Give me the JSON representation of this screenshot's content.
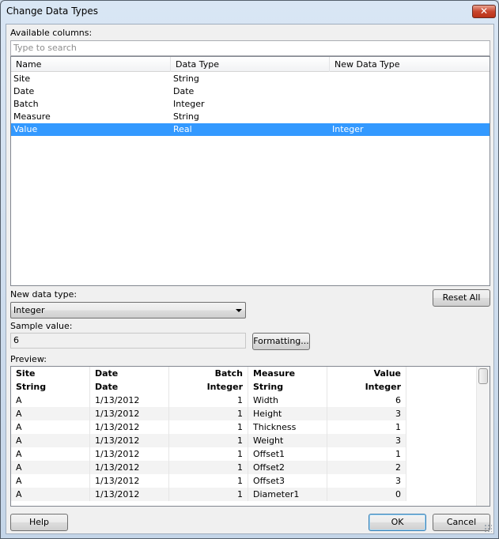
{
  "window": {
    "title": "Change Data Types",
    "close_glyph": "✕"
  },
  "available": {
    "label": "Available columns:",
    "search_placeholder": "Type to search",
    "headers": [
      "Name",
      "Data Type",
      "New Data Type"
    ],
    "rows": [
      {
        "name": "Site",
        "type": "String",
        "new_type": ""
      },
      {
        "name": "Date",
        "type": "Date",
        "new_type": ""
      },
      {
        "name": "Batch",
        "type": "Integer",
        "new_type": ""
      },
      {
        "name": "Measure",
        "type": "String",
        "new_type": ""
      },
      {
        "name": "Value",
        "type": "Real",
        "new_type": "Integer",
        "selected": true
      }
    ]
  },
  "new_type": {
    "label": "New data type:",
    "value": "Integer"
  },
  "reset_all_label": "Reset All",
  "sample": {
    "label": "Sample value:",
    "value": "6"
  },
  "formatting_label": "Formatting...",
  "preview": {
    "label": "Preview:",
    "headers": [
      "Site",
      "Date",
      "Batch",
      "Measure",
      "Value"
    ],
    "types": [
      "String",
      "Date",
      "Integer",
      "String",
      "Integer"
    ],
    "rows": [
      [
        "A",
        "1/13/2012",
        "1",
        "Width",
        "6"
      ],
      [
        "A",
        "1/13/2012",
        "1",
        "Height",
        "3"
      ],
      [
        "A",
        "1/13/2012",
        "1",
        "Thickness",
        "1"
      ],
      [
        "A",
        "1/13/2012",
        "1",
        "Weight",
        "3"
      ],
      [
        "A",
        "1/13/2012",
        "1",
        "Offset1",
        "1"
      ],
      [
        "A",
        "1/13/2012",
        "1",
        "Offset2",
        "2"
      ],
      [
        "A",
        "1/13/2012",
        "1",
        "Offset3",
        "3"
      ],
      [
        "A",
        "1/13/2012",
        "1",
        "Diameter1",
        "0"
      ]
    ]
  },
  "buttons": {
    "help": "Help",
    "ok": "OK",
    "cancel": "Cancel"
  },
  "colors": {
    "selection": "#3399ff",
    "close_button": "#c8462e"
  }
}
